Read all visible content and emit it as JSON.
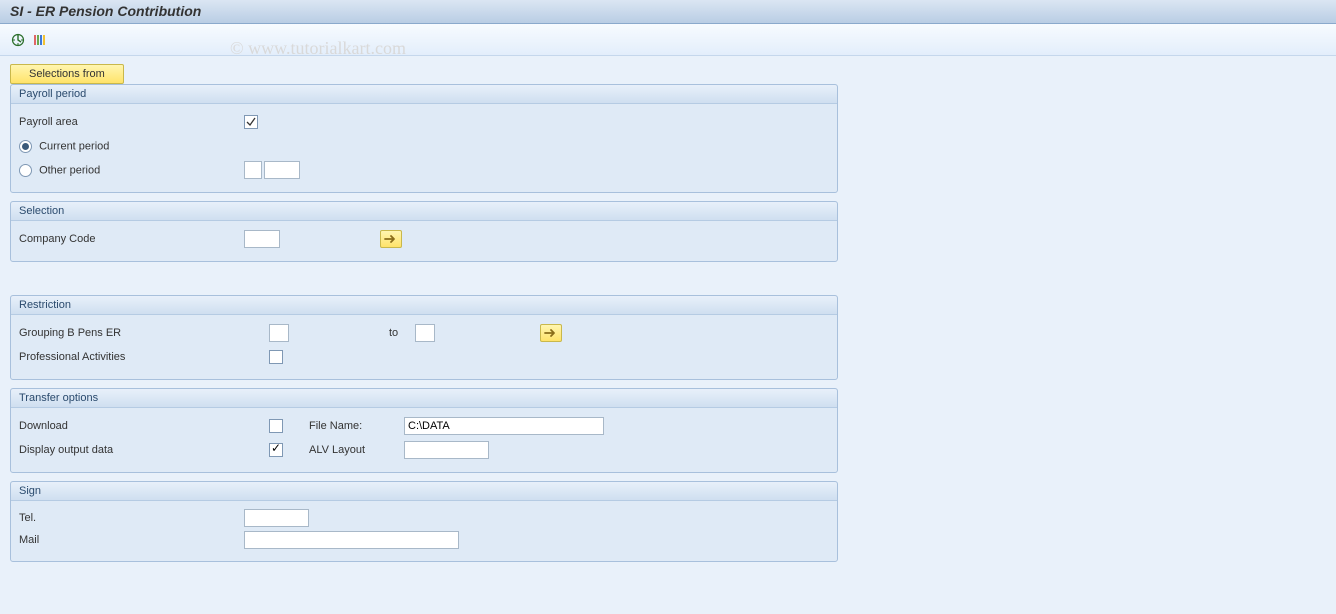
{
  "title": "SI - ER Pension Contribution",
  "watermark": "© www.tutorialkart.com",
  "buttons": {
    "selections_from": "Selections from"
  },
  "groups": {
    "payroll_period": {
      "legend": "Payroll period",
      "payroll_area_label": "Payroll area",
      "payroll_area_value": "",
      "current_period_label": "Current period",
      "other_period_label": "Other period",
      "other_period_from": "",
      "other_period_to": ""
    },
    "selection": {
      "legend": "Selection",
      "company_code_label": "Company Code",
      "company_code_value": ""
    },
    "restriction": {
      "legend": "Restriction",
      "grouping_label": "Grouping B Pens ER",
      "grouping_from": "",
      "to_label": "to",
      "grouping_to": "",
      "prof_act_label": "Professional Activities"
    },
    "transfer": {
      "legend": "Transfer options",
      "download_label": "Download",
      "file_name_label": "File Name:",
      "file_name_value": "C:\\DATA",
      "display_label": "Display output data",
      "alv_label": "ALV Layout",
      "alv_value": ""
    },
    "sign": {
      "legend": "Sign",
      "tel_label": "Tel.",
      "tel_value": "",
      "mail_label": "Mail",
      "mail_value": ""
    }
  }
}
